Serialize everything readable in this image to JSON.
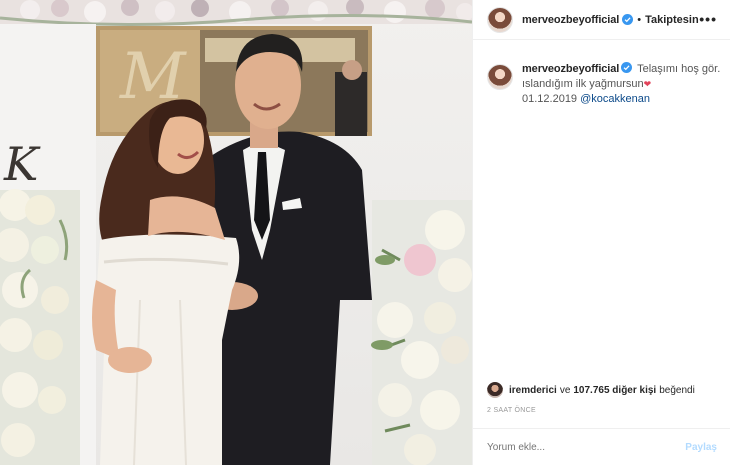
{
  "post": {
    "username": "merveozbeyofficial",
    "separator": "•",
    "follow_label": "Takiptesin",
    "more_label": "•••",
    "caption_text": "Telaşımı hoş gör. ıslandığım ilk yağmursun",
    "caption_date": "01.12.2019",
    "caption_mention": "@kocakkenan",
    "likes_user": "iremderici",
    "likes_connector": "ve",
    "likes_count_text": "107.765 diğer kişi",
    "likes_suffix": "beğendi",
    "timestamp": "2 SAAT ÖNCE",
    "comment_placeholder": "Yorum ekle...",
    "post_button": "Paylaş"
  },
  "photo": {
    "monogram_left": "M",
    "monogram_right": "K"
  },
  "colors": {
    "verified_blue": "#3897f0",
    "heart_red": "#e2435a",
    "mention_blue": "#0c4a8a",
    "post_disabled": "#b3dbff"
  },
  "icons": {
    "verified": "verified-badge-icon",
    "heart": "heart-icon",
    "more": "more-options-icon"
  }
}
